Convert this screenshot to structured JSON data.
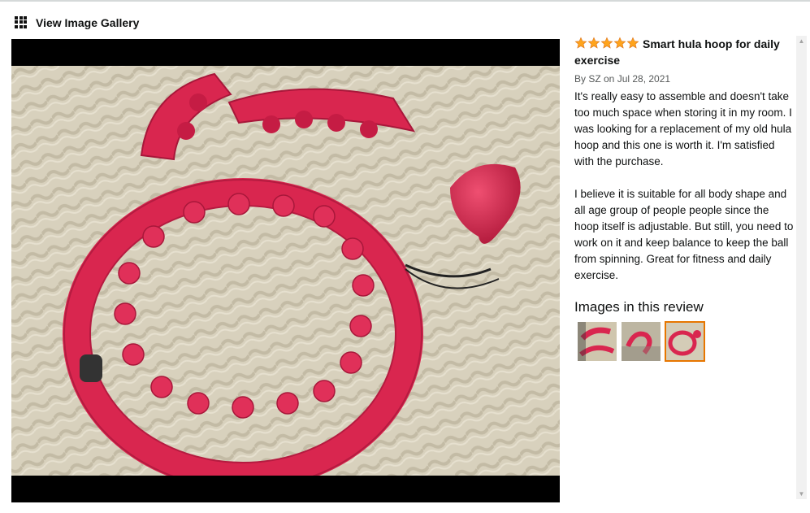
{
  "header": {
    "label": "View Image Gallery",
    "icon": "grid-icon"
  },
  "review": {
    "rating": 5,
    "max_rating": 5,
    "star_color": "#ffa41c",
    "title": "Smart hula hoop for daily exercise",
    "byline": "By SZ on Jul 28, 2021",
    "paragraphs": [
      "It's really easy to assemble and doesn't take too much space when storing it in my room. I was looking for a replacement of my old hula hoop and this one is worth it. I'm satisfied with the purchase.",
      "I believe it is suitable for all body shape and all age group of people people since the hoop itself is adjustable. But still, you need to work on it and keep balance to keep the ball from spinning. Great for fitness and daily exercise."
    ]
  },
  "images_section": {
    "heading": "Images in this review",
    "selected_index": 2,
    "highlight_color": "#e77600"
  },
  "viewer": {
    "subject": "pink smart hula hoop with weighted ball on beige bedspread",
    "hoop_color": "#d9264f"
  }
}
